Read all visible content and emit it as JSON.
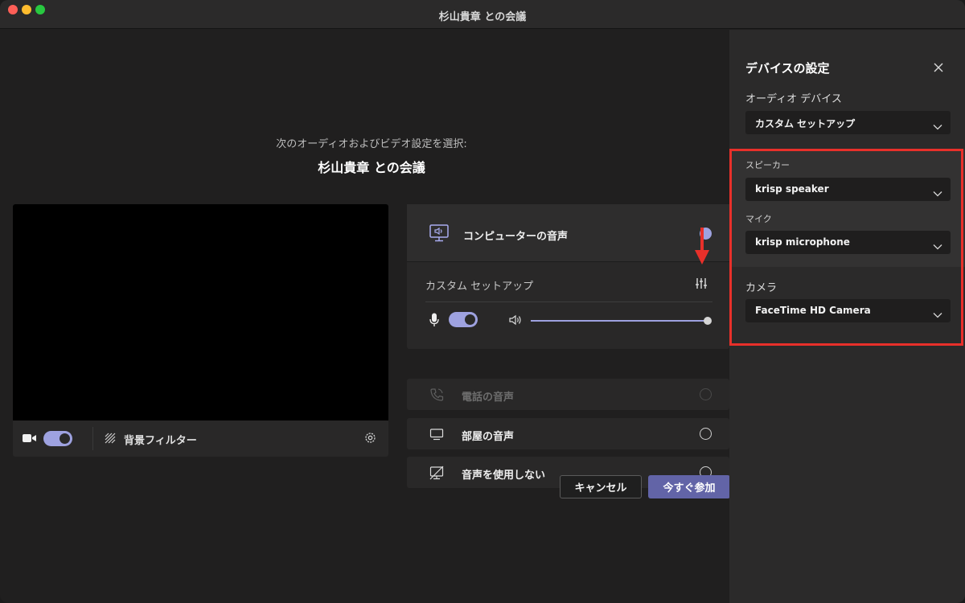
{
  "window": {
    "title": "杉山貴章 との会議"
  },
  "main": {
    "prompt": "次のオーディオおよびビデオ設定を選択:",
    "meeting_title": "杉山貴章 との会議",
    "video": {
      "camera_toggle_on": true,
      "background_filter_label": "背景フィルター"
    },
    "audio_options": {
      "computer_audio": {
        "label": "コンピューターの音声",
        "selected": true
      },
      "custom_setup_label": "カスタム セットアップ",
      "mic_toggle_on": true,
      "volume_level": 1.0,
      "phone_audio": {
        "label": "電話の音声",
        "enabled": false
      },
      "room_audio": {
        "label": "部屋の音声"
      },
      "no_audio": {
        "label": "音声を使用しない"
      }
    },
    "buttons": {
      "cancel": "キャンセル",
      "join": "今すぐ参加"
    }
  },
  "device_settings": {
    "title": "デバイスの設定",
    "audio_device_label": "オーディオ デバイス",
    "audio_device_value": "カスタム セットアップ",
    "speaker_label": "スピーカー",
    "speaker_value": "krisp speaker",
    "mic_label": "マイク",
    "mic_value": "krisp microphone",
    "camera_label": "カメラ",
    "camera_value": "FaceTime HD Camera"
  },
  "colors": {
    "accent": "#6264a7",
    "toggle": "#9ea2e0",
    "highlight_border": "#e8302a",
    "annotation_arrow": "#e8302a"
  },
  "icons": [
    "camera-icon",
    "background-filter-icon",
    "gear-icon",
    "computer-audio-icon",
    "sliders-icon",
    "mic-icon",
    "speaker-volume-icon",
    "phone-icon",
    "room-icon",
    "no-audio-icon",
    "close-icon",
    "chevron-down-icon",
    "arrow-down-icon"
  ]
}
